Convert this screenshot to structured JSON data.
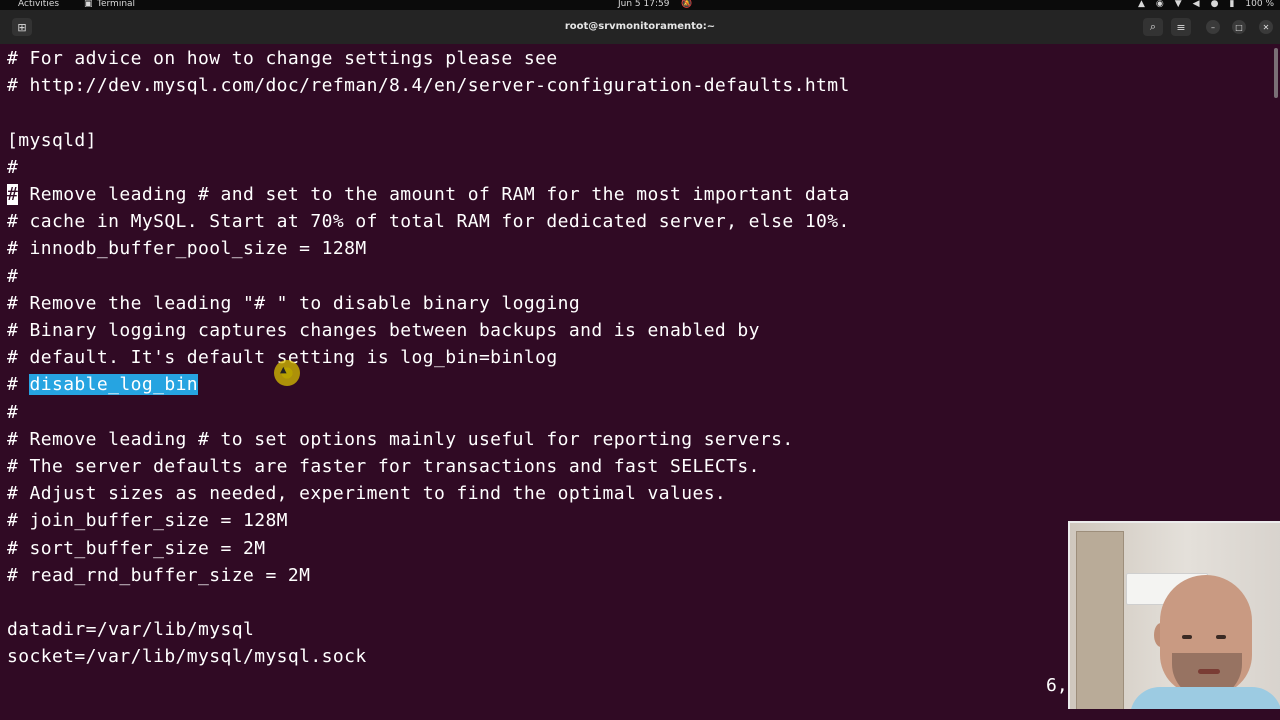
{
  "topbar": {
    "activities": "Activities",
    "app_name": "Terminal",
    "datetime": "Jun 5  17:59",
    "battery": "100 %"
  },
  "window": {
    "title": "root@srvmonitoramento:~"
  },
  "editor": {
    "lines": [
      "# For advice on how to change settings please see",
      "# http://dev.mysql.com/doc/refman/8.4/en/server-configuration-defaults.html",
      "",
      "[mysqld]",
      "#",
      " Remove leading # and set to the amount of RAM for the most important data",
      "# cache in MySQL. Start at 70% of total RAM for dedicated server, else 10%.",
      "# innodb_buffer_pool_size = 128M",
      "#",
      "# Remove the leading \"# \" to disable binary logging",
      "# Binary logging captures changes between backups and is enabled by",
      "# default. It's default setting is log_bin=binlog",
      "# ",
      "#",
      "# Remove leading # to set options mainly useful for reporting servers.",
      "# The server defaults are faster for transactions and fast SELECTs.",
      "# Adjust sizes as needed, experiment to find the optimal values.",
      "# join_buffer_size = 128M",
      "# sort_buffer_size = 2M",
      "# read_rnd_buffer_size = 2M",
      "",
      "datadir=/var/lib/mysql",
      "socket=/var/lib/mysql/mysql.sock"
    ],
    "cursor_char": "#",
    "selected_text": "disable_log_bin",
    "status_position": "6,"
  },
  "icons": {
    "new_tab": "new-tab-icon",
    "search": "search-icon",
    "menu": "hamburger-menu-icon",
    "minimize": "minimize-icon",
    "maximize": "maximize-icon",
    "close": "close-icon"
  }
}
